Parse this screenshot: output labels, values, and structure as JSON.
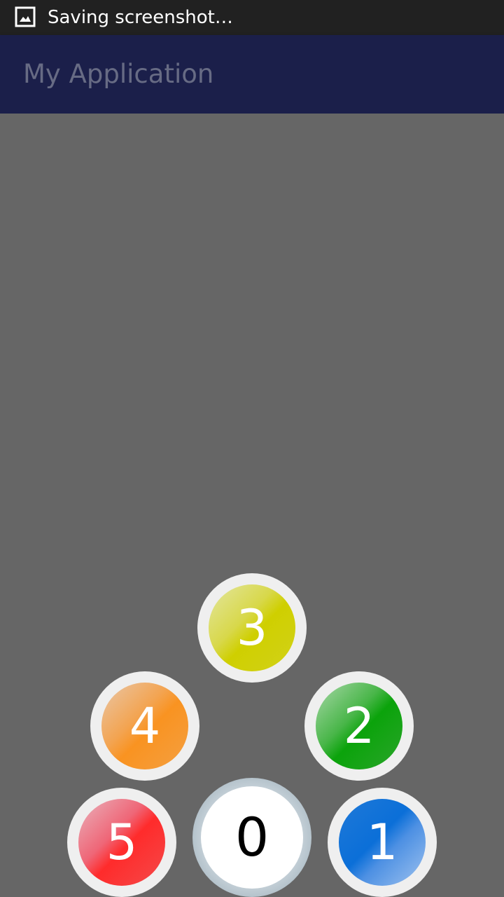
{
  "status_bar": {
    "icon": "screenshot-icon",
    "text": "Saving screenshot…"
  },
  "app_bar": {
    "title": "My Application"
  },
  "buttons": {
    "zero": {
      "label": "0",
      "color": "#ffffff"
    },
    "one": {
      "label": "1",
      "color": "#0b6fd8"
    },
    "two": {
      "label": "2",
      "color": "#0ba30b"
    },
    "three": {
      "label": "3",
      "color": "#cfcf00"
    },
    "four": {
      "label": "4",
      "color": "#f99321"
    },
    "five": {
      "label": "5",
      "color": "#ff2b2b"
    }
  }
}
